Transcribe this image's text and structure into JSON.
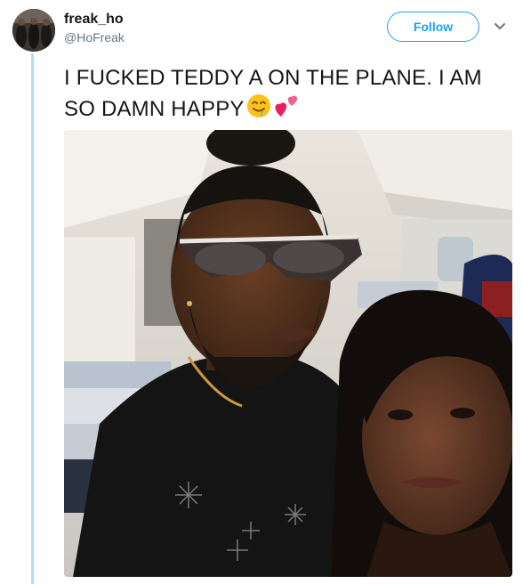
{
  "user": {
    "display_name": "freak_ho",
    "handle": "@HoFreak"
  },
  "follow_button": {
    "label": "Follow"
  },
  "tweet": {
    "text_line1": "I FUCKED TEDDY A ON THE PLANE. I AM",
    "text_line2": "SO DAMN HAPPY",
    "emojis": [
      "drooling-smile-face",
      "two-hearts"
    ]
  },
  "colors": {
    "accent": "#1da1f2",
    "thread_line": "#b3dcf4",
    "handle_gray": "#657786",
    "text": "#14171a"
  },
  "icons": {
    "menu": "chevron-down-icon"
  }
}
